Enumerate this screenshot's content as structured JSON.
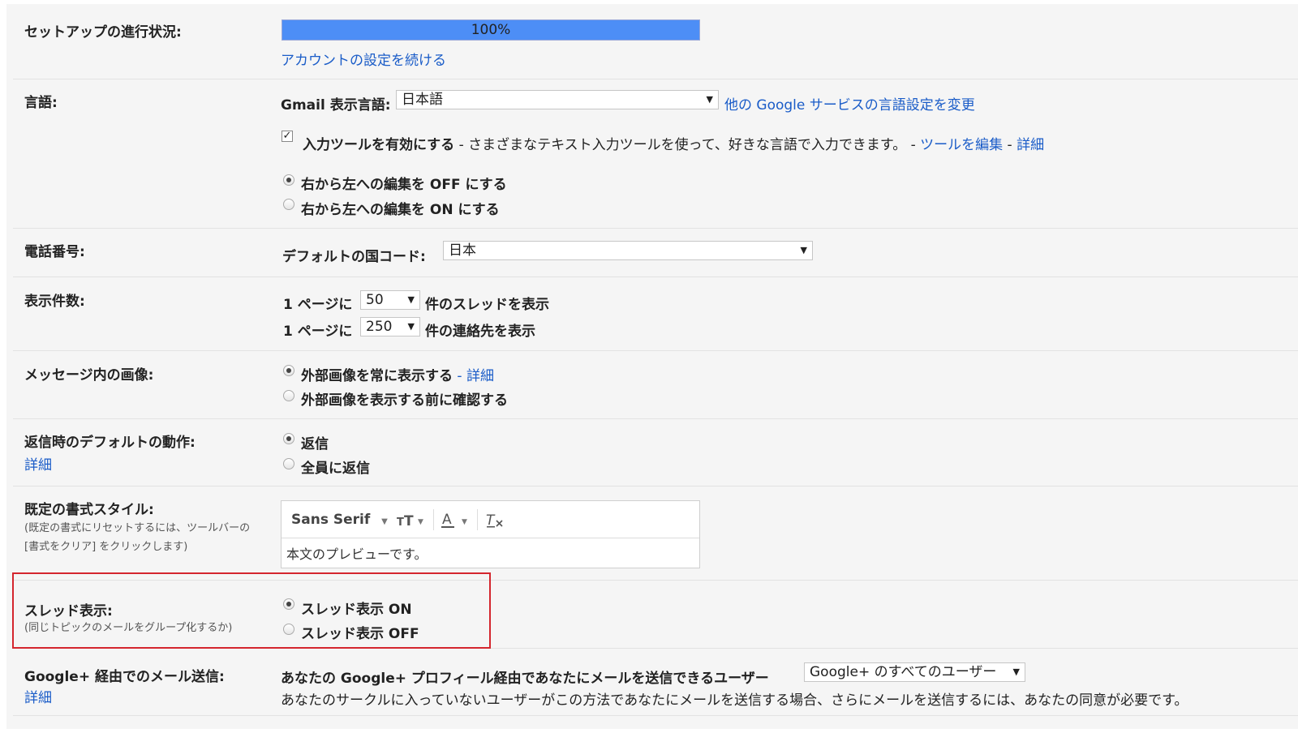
{
  "setup": {
    "label": "セットアップの進行状況:",
    "progress_text": "100%",
    "progress_fraction": 1.0,
    "continue_link": "アカウントの設定を続ける"
  },
  "language": {
    "label": "言語:",
    "gmail_lang_label": "Gmail 表示言語:",
    "gmail_lang_value": "日本語",
    "other_services_link": "他の Google サービスの言語設定を変更",
    "input_tools_label": "入力ツールを有効にする",
    "input_tools_desc": " - さまざまなテキスト入力ツールを使って、好きな言語で入力できます。 - ",
    "edit_tools_link": "ツールを編集",
    "sep": " - ",
    "details_link": "詳細",
    "rtl_off": "右から左への編集を OFF にする",
    "rtl_on": "右から左への編集を ON にする"
  },
  "phone": {
    "label": "電話番号:",
    "country_label": "デフォルトの国コード:",
    "country_value": "日本"
  },
  "page_size": {
    "label": "表示件数:",
    "prefix": "1 ページに",
    "threads_value": "50",
    "threads_suffix": "件のスレッドを表示",
    "contacts_value": "250",
    "contacts_suffix": "件の連絡先を表示"
  },
  "images": {
    "label": "メッセージ内の画像:",
    "always_show": "外部画像を常に表示する",
    "dash": " - ",
    "details_link": "詳細",
    "ask_before": "外部画像を表示する前に確認する"
  },
  "reply": {
    "label": "返信時のデフォルトの動作:",
    "details_link": "詳細",
    "reply": "返信",
    "reply_all": "全員に返信"
  },
  "format": {
    "label": "既定の書式スタイル:",
    "hint_line1": "(既定の書式にリセットするには、ツールバーの",
    "hint_line2": "[書式をクリア] をクリックします)",
    "font_name": "Sans Serif",
    "preview_text": "本文のプレビューです。"
  },
  "thread": {
    "label": "スレッド表示:",
    "hint": "(同じトピックのメールをグループ化するか)",
    "on": "スレッド表示 ON",
    "off": "スレッド表示 OFF"
  },
  "gplus": {
    "label": "Google+ 経由でのメール送信:",
    "details_link": "詳細",
    "who_label": "あなたの Google+ プロフィール経由であなたにメールを送信できるユーザー",
    "who_value": "Google+ のすべてのユーザー",
    "note": "あなたのサークルに入っていないユーザーがこの方法であなたにメールを送信する場合、さらにメールを送信するには、あなたの同意が必要です。"
  },
  "colors": {
    "progress_fill": "#4d8ef6",
    "link": "#1a5cc8",
    "highlight_border": "#d4262e"
  }
}
